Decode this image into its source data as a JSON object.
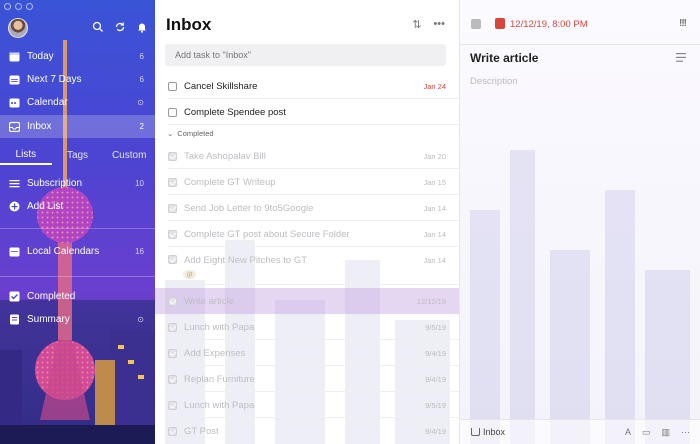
{
  "sidebar": {
    "items": [
      {
        "label": "Today",
        "count": "6",
        "icon": "calendar-today-icon"
      },
      {
        "label": "Next 7 Days",
        "count": "6",
        "icon": "calendar-week-icon"
      },
      {
        "label": "Calendar",
        "icon": "calendar-month-icon"
      },
      {
        "label": "Inbox",
        "count": "2",
        "icon": "inbox-icon"
      }
    ],
    "tabs": [
      "Lists",
      "Tags",
      "Custom"
    ],
    "lists": [
      {
        "label": "Subscription",
        "count": "10",
        "icon": "list-icon"
      },
      {
        "label": "Add List",
        "icon": "add-circle-icon"
      },
      {
        "label": "Local Calendars",
        "count": "16",
        "icon": "calendar-local-icon"
      }
    ],
    "bottom": [
      {
        "label": "Completed",
        "icon": "checkbox-icon"
      },
      {
        "label": "Summary",
        "icon": "summary-icon"
      }
    ]
  },
  "list": {
    "title": "Inbox",
    "add_placeholder": "Add task to \"Inbox\"",
    "open_tasks": [
      {
        "title": "Cancel Skillshare",
        "date": "Jan 24"
      },
      {
        "title": "Complete Spendee post",
        "date": ""
      }
    ],
    "completed_label": "Completed",
    "completed_tasks": [
      {
        "title": "Take Ashopalav Bill",
        "date": "Jan 20"
      },
      {
        "title": "Complete GT Writeup",
        "date": "Jan 15"
      },
      {
        "title": "Send Job Letter to 9to5Google",
        "date": "Jan 14"
      },
      {
        "title": "Complete GT post about Secure Folder",
        "date": "Jan 14"
      },
      {
        "title": "Add Eight New Pitches to GT",
        "date": "Jan 14"
      },
      {
        "title": "Write article",
        "date": "12/12/19"
      },
      {
        "title": "Lunch with Papa",
        "date": "9/5/19"
      },
      {
        "title": "Add Expenses",
        "date": "9/4/19"
      },
      {
        "title": "Replan Furniture",
        "date": "9/4/19"
      },
      {
        "title": "Lunch with Papa",
        "date": "9/5/19"
      },
      {
        "title": "GT Post",
        "date": "9/4/19"
      }
    ],
    "tag": "gt"
  },
  "detail": {
    "date": "12/12/19, 8:00 PM",
    "priority": "!!!",
    "title": "Write article",
    "description_placeholder": "Description",
    "list_name": "Inbox"
  },
  "colors": {
    "accent": "#4a4fd8",
    "due": "#d9453c"
  }
}
